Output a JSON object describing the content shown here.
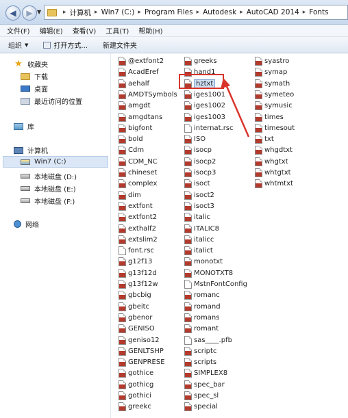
{
  "address_bar": {
    "crumbs": [
      "计算机",
      "Win7 (C:)",
      "Program Files",
      "Autodesk",
      "AutoCAD 2014",
      "Fonts"
    ]
  },
  "menu": [
    "文件(F)",
    "编辑(E)",
    "查看(V)",
    "工具(T)",
    "帮助(H)"
  ],
  "toolbar": {
    "organize": "组织",
    "open_with": "打开方式...",
    "new_folder": "新建文件夹"
  },
  "nav": {
    "favorites": "收藏夹",
    "downloads": "下载",
    "desktop": "桌面",
    "recent": "最近访问的位置",
    "libraries": "库",
    "computer": "计算机",
    "drives": [
      "Win7 (C:)",
      "本地磁盘 (D:)",
      "本地磁盘 (E:)",
      "本地磁盘 (F:)"
    ],
    "network": "网络"
  },
  "files": {
    "col1": [
      "@extfont2",
      "AcadEref",
      "aehalf",
      "AMDTSymbols",
      "amgdt",
      "amgdtans",
      "bigfont",
      "bold",
      "Cdm",
      "CDM_NC",
      "chineset",
      "complex",
      "dim",
      "extfont",
      "extfont2",
      "exthalf2",
      "extslim2",
      "font.rsc",
      "g12f13",
      "g13f12d",
      "g13f12w",
      "gbcbig",
      "gbeitc",
      "gbenor",
      "GENISO",
      "geniso12",
      "GENLTSHP",
      "GENPRESE",
      "gothice",
      "gothicg",
      "gothici",
      "greekc"
    ],
    "col2": [
      "greeks",
      "hand1",
      "hztxt",
      "iges1001",
      "iges1002",
      "iges1003",
      "internat.rsc",
      "ISO",
      "isocp",
      "isocp2",
      "isocp3",
      "isoct",
      "isoct2",
      "isoct3",
      "italic",
      "ITALIC8",
      "italicc",
      "italict",
      "monotxt",
      "MONOTXT8",
      "MstnFontConfig",
      "romanc",
      "romand",
      "romans",
      "romant",
      "sas____.pfb",
      "scriptc",
      "scripts",
      "SIMPLEX8",
      "spec_bar",
      "spec_sl",
      "special"
    ],
    "col3": [
      "syastro",
      "symap",
      "symath",
      "symeteo",
      "symusic",
      "times",
      "timesout",
      "txt",
      "whgdtxt",
      "whgtxt",
      "whtgtxt",
      "whtmtxt"
    ],
    "plain_files": [
      "font.rsc",
      "internat.rsc",
      "sas____.pfb",
      "MstnFontConfig"
    ],
    "selected": "hztxt"
  },
  "colors": {
    "accent_red": "#d9342b",
    "selection": "#cfe1f7",
    "font_icon": "#b33a2c"
  }
}
